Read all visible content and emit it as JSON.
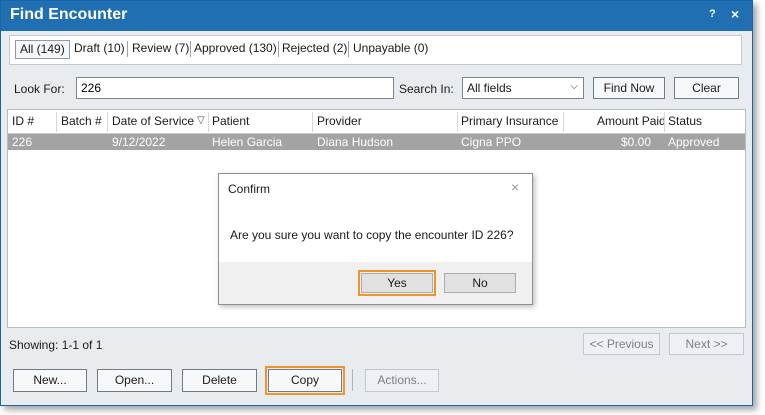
{
  "window": {
    "title": "Find Encounter",
    "help_glyph": "?",
    "close_glyph": "×"
  },
  "tabs": [
    {
      "label": "All (149)"
    },
    {
      "label": "Draft (10)"
    },
    {
      "label": "Review (7)"
    },
    {
      "label": "Approved (130)"
    },
    {
      "label": "Rejected (2)"
    },
    {
      "label": "Unpayable (0)"
    }
  ],
  "search": {
    "look_for_label": "Look For:",
    "look_for_value": "226",
    "search_in_label": "Search In:",
    "search_in_value": "All fields",
    "find_now_label": "Find Now",
    "clear_label": "Clear"
  },
  "grid": {
    "columns": [
      "ID #",
      "Batch #",
      "Date of Service",
      "Patient",
      "Provider",
      "Primary Insurance",
      "Amount Paid",
      "Status"
    ],
    "sort_indicator": "▽",
    "rows": [
      {
        "id": "226",
        "batch": "",
        "date": "9/12/2022",
        "patient": "Helen Garcia",
        "provider": "Diana Hudson",
        "insurance": "Cigna PPO",
        "amount": "$0.00",
        "status": "Approved"
      }
    ]
  },
  "dialog": {
    "title": "Confirm",
    "close_glyph": "×",
    "message": "Are you sure you want to copy the encounter ID 226?",
    "yes_label": "Yes",
    "no_label": "No"
  },
  "footer": {
    "status_text": "Showing: 1-1 of 1",
    "previous_label": "<< Previous",
    "next_label": "Next >>"
  },
  "actions": {
    "new_label": "New...",
    "open_label": "Open...",
    "delete_label": "Delete",
    "copy_label": "Copy",
    "actions_label": "Actions..."
  },
  "colors": {
    "titlebar": "#1f6fb2",
    "selected_row": "#a3a3a3",
    "highlight": "#f0952b"
  }
}
